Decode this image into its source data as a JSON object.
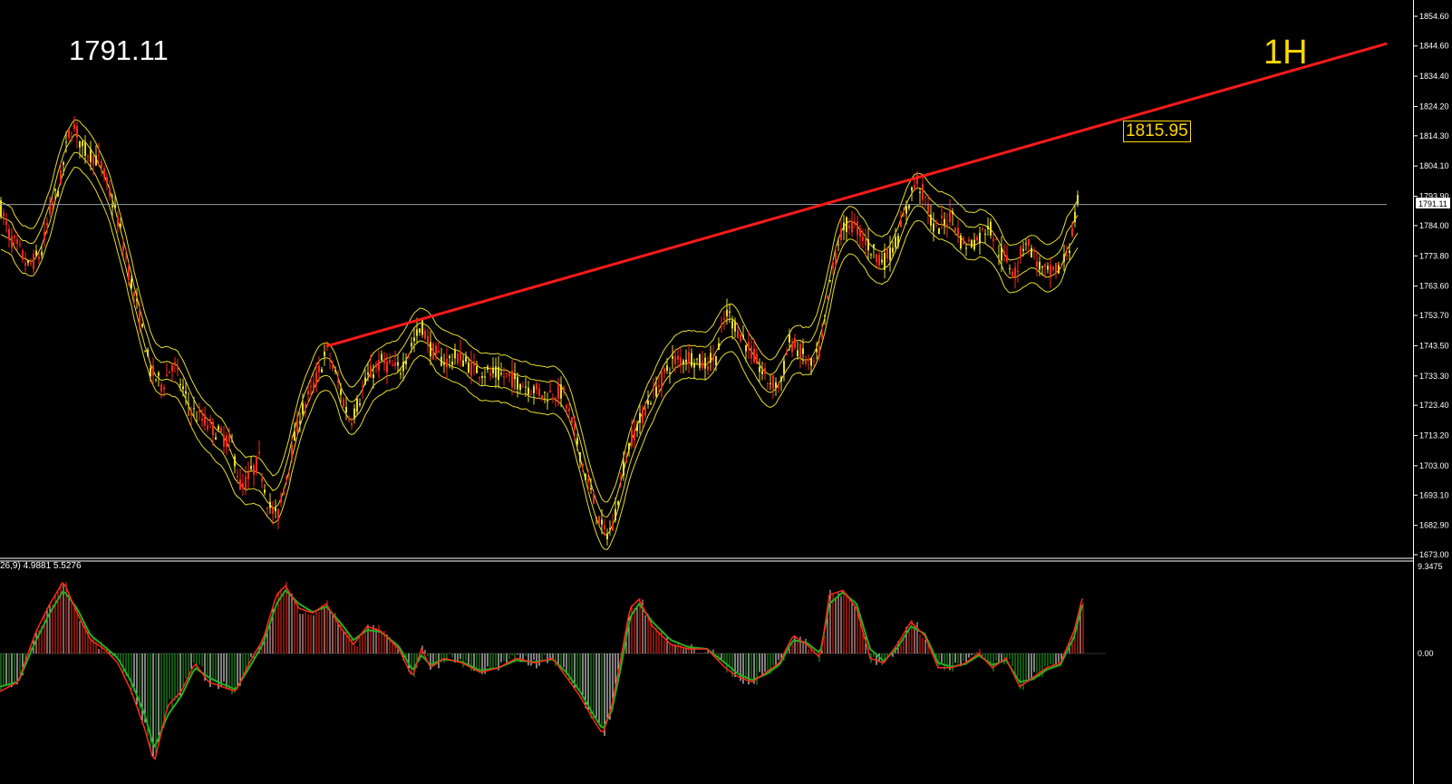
{
  "header": {
    "price_readout": "1791.11",
    "timeframe": "1H",
    "trendline_tag": "1815.95",
    "current_price_tag": "1791.11"
  },
  "macd": {
    "params_text": "26,9) 4.9881 5.5276",
    "axis_top_label": "9.3475",
    "axis_zero_label": "0.00"
  },
  "colors": {
    "background": "#000000",
    "axis": "#ffffff",
    "trendline": "#ff1a1a",
    "bands": "#e6dc2e",
    "candle_up": "#e6dc2e",
    "candle_down": "#ff2a1a",
    "hist_pos_strong": "#ff2a1a",
    "hist_pos_weak": "#ffc0c0",
    "hist_neg_strong": "#22b022",
    "hist_neg_weak": "#ffffff",
    "macd_line": "#ff2a1a",
    "signal_line": "#22b022",
    "label_yellow": "#ffd800"
  },
  "chart_data": [
    {
      "type": "line",
      "title": "",
      "timeframe": "1H",
      "ylim": [
        1673.0,
        1854.6
      ],
      "y_ticks": [
        "1854.60",
        "1844.60",
        "1834.40",
        "1824.20",
        "1814.30",
        "1804.10",
        "1793.90",
        "1784.00",
        "1773.80",
        "1763.60",
        "1753.70",
        "1743.50",
        "1733.30",
        "1723.40",
        "1713.20",
        "1703.00",
        "1693.10",
        "1682.90",
        "1673.00"
      ],
      "current_price": 1791.11,
      "series": [
        {
          "name": "",
          "x": [
            0,
            10,
            20,
            30,
            45,
            55,
            65,
            75,
            82,
            90,
            100,
            110,
            120,
            130,
            140,
            155,
            165,
            178,
            190,
            205,
            215,
            225,
            240,
            255,
            265,
            275,
            285,
            295,
            305,
            315,
            330,
            345,
            360,
            375,
            385,
            395,
            405,
            420,
            440,
            455,
            465,
            475,
            490,
            505,
            520,
            540,
            560,
            580,
            600,
            620,
            635,
            645,
            655,
            665,
            675,
            685,
            695,
            705,
            715,
            725,
            740,
            760,
            775,
            790,
            800,
            815,
            830,
            845,
            860,
            870,
            880,
            895,
            905,
            915,
            925,
            935,
            945,
            960,
            975,
            990,
            1000,
            1010,
            1020,
            1030,
            1040,
            1050,
            1060,
            1070,
            1080,
            1090,
            1100,
            1110,
            1120,
            1130,
            1140,
            1150,
            1160,
            1170,
            1180,
            1190
          ],
          "values": [
            1790,
            1780,
            1776,
            1770,
            1775,
            1790,
            1798,
            1815,
            1817,
            1810,
            1808,
            1805,
            1795,
            1785,
            1770,
            1750,
            1735,
            1730,
            1738,
            1725,
            1720,
            1718,
            1714,
            1710,
            1695,
            1700,
            1705,
            1690,
            1685,
            1700,
            1720,
            1730,
            1742,
            1728,
            1718,
            1725,
            1733,
            1738,
            1735,
            1745,
            1750,
            1742,
            1738,
            1740,
            1736,
            1734,
            1733,
            1730,
            1727,
            1728,
            1712,
            1700,
            1690,
            1680,
            1682,
            1700,
            1712,
            1718,
            1725,
            1730,
            1738,
            1740,
            1737,
            1740,
            1755,
            1748,
            1740,
            1732,
            1730,
            1745,
            1742,
            1736,
            1743,
            1765,
            1780,
            1785,
            1783,
            1776,
            1772,
            1780,
            1790,
            1800,
            1793,
            1782,
            1785,
            1788,
            1778,
            1778,
            1780,
            1785,
            1776,
            1772,
            1768,
            1780,
            1774,
            1768,
            1768,
            1770,
            1778,
            1795
          ]
        },
        {
          "name": "",
          "x": [
            360,
            1530
          ],
          "values": [
            1743.3,
            1845.4
          ]
        }
      ]
    },
    {
      "type": "bar",
      "title": "",
      "params": "26,9) 4.9881 5.5276",
      "ylim": [
        -12.5,
        9.3475
      ],
      "x": [
        0,
        20,
        40,
        55,
        70,
        85,
        100,
        115,
        130,
        145,
        160,
        170,
        185,
        200,
        215,
        230,
        245,
        260,
        275,
        290,
        305,
        315,
        330,
        345,
        360,
        375,
        390,
        405,
        420,
        440,
        455,
        465,
        475,
        490,
        510,
        530,
        550,
        570,
        590,
        610,
        625,
        640,
        655,
        665,
        675,
        685,
        695,
        705,
        720,
        740,
        760,
        780,
        800,
        815,
        830,
        845,
        860,
        875,
        890,
        905,
        915,
        930,
        945,
        960,
        975,
        990,
        1005,
        1020,
        1035,
        1050,
        1065,
        1080,
        1095,
        1110,
        1125,
        1140,
        1155,
        1170,
        1185,
        1195
      ],
      "values": [
        -4.0,
        -3.0,
        2.5,
        5.5,
        8.0,
        4.5,
        1.5,
        0.5,
        -1.0,
        -4.0,
        -8.0,
        -11.5,
        -5.5,
        -4.0,
        -1.0,
        -3.0,
        -3.5,
        -4.0,
        -1.0,
        1.5,
        6.5,
        7.5,
        5.0,
        4.5,
        5.5,
        3.0,
        1.0,
        3.0,
        2.5,
        0.5,
        -2.5,
        0.5,
        -1.5,
        -0.5,
        -1.0,
        -2.0,
        -1.5,
        -0.5,
        -1.0,
        -0.5,
        -2.5,
        -4.5,
        -7.0,
        -8.5,
        -5.5,
        -0.5,
        5.0,
        6.0,
        3.0,
        1.0,
        0.5,
        0.5,
        -1.5,
        -2.5,
        -3.0,
        -2.0,
        -1.0,
        2.0,
        1.0,
        -0.5,
        6.5,
        7.0,
        5.0,
        -0.5,
        -1.0,
        1.0,
        3.5,
        2.0,
        -1.5,
        -1.5,
        -1.0,
        0.0,
        -1.5,
        -0.5,
        -3.5,
        -2.5,
        -1.5,
        -1.0,
        2.5,
        6.5
      ],
      "series": [
        {
          "name": "",
          "values": [
            -4.0,
            -3.0,
            2.5,
            5.5,
            8.0,
            4.5,
            1.5,
            0.5,
            -1.0,
            -4.0,
            -8.0,
            -11.5,
            -5.5,
            -4.0,
            -1.0,
            -3.0,
            -3.5,
            -4.0,
            -1.0,
            1.5,
            6.5,
            7.5,
            5.0,
            4.5,
            5.5,
            3.0,
            1.0,
            3.0,
            2.5,
            0.5,
            -2.5,
            0.5,
            -1.5,
            -0.5,
            -1.0,
            -2.0,
            -1.5,
            -0.5,
            -1.0,
            -0.5,
            -2.5,
            -4.5,
            -7.0,
            -8.5,
            -5.5,
            -0.5,
            5.0,
            6.0,
            3.0,
            1.0,
            0.5,
            0.5,
            -1.5,
            -2.5,
            -3.0,
            -2.0,
            -1.0,
            2.0,
            1.0,
            -0.5,
            6.5,
            7.0,
            5.0,
            -0.5,
            -1.0,
            1.0,
            3.5,
            2.0,
            -1.5,
            -1.5,
            -1.0,
            0.0,
            -1.5,
            -0.5,
            -3.5,
            -2.5,
            -1.5,
            -1.0,
            2.5,
            6.5
          ]
        },
        {
          "name": "",
          "values": [
            -3.5,
            -3.0,
            1.5,
            4.5,
            7.0,
            5.0,
            2.0,
            0.8,
            -0.5,
            -3.0,
            -6.5,
            -10.0,
            -6.5,
            -4.5,
            -1.5,
            -2.5,
            -3.2,
            -3.8,
            -1.5,
            1.0,
            5.5,
            7.0,
            5.5,
            4.6,
            5.2,
            3.5,
            1.5,
            2.6,
            2.4,
            0.8,
            -1.8,
            -0.2,
            -1.2,
            -0.6,
            -0.9,
            -1.8,
            -1.5,
            -0.7,
            -0.9,
            -0.6,
            -2.0,
            -4.0,
            -6.5,
            -8.0,
            -6.0,
            -1.5,
            4.0,
            5.5,
            3.5,
            1.5,
            0.7,
            0.5,
            -1.0,
            -2.2,
            -2.8,
            -2.2,
            -1.2,
            1.5,
            1.2,
            0.0,
            5.5,
            6.8,
            5.5,
            0.5,
            -0.8,
            0.6,
            3.0,
            2.2,
            -1.0,
            -1.4,
            -1.1,
            -0.2,
            -1.2,
            -0.7,
            -3.0,
            -2.7,
            -1.7,
            -1.2,
            1.8,
            5.8
          ]
        }
      ]
    }
  ]
}
